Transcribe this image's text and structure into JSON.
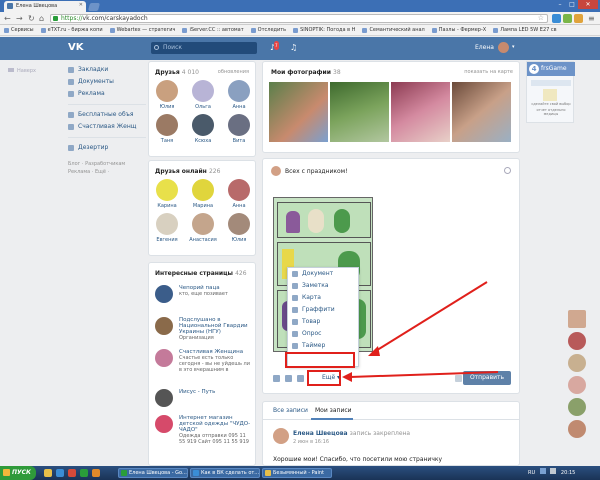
{
  "browser": {
    "tab_title": "Елена Швецова",
    "url_https": "https://",
    "url_rest": "vk.com/carskayadoch",
    "bookmarks": [
      "Сервисы",
      "eTXT.ru - биржа копи",
      "Webartex — стратегич",
      "iServer.CC :: автомат",
      "Отследить",
      "SINOPTIK: Погода в Н",
      "Семантический анал",
      "Пазлы - Фермер-Х",
      "Лампа LED 5W E27 св"
    ]
  },
  "header": {
    "logo": "VK",
    "search_placeholder": "Поиск",
    "notification_count": "7",
    "user_name": "Елена"
  },
  "left_menu": {
    "items": [
      "Закладки",
      "Документы",
      "Реклама"
    ],
    "items2": [
      "Бесплатные объя",
      "Счастливая Женщ"
    ],
    "items3": [
      "Дезертир"
    ],
    "footer1": "Блог · Разработчикам",
    "footer2": "Реклама · Ещё ·"
  },
  "side_far": {
    "label": "Наверх"
  },
  "friends": {
    "title": "Друзья",
    "count": "4 010",
    "link": "обновления",
    "names": [
      "Юлия",
      "Ольга",
      "Анна",
      "Таня",
      "Ксюха",
      "Вита"
    ]
  },
  "friends_online": {
    "title": "Друзья онлайн",
    "count": "226",
    "names": [
      "Карина",
      "Марина",
      "Анна",
      "Евгения",
      "Анастасия",
      "Юлия"
    ]
  },
  "pages": {
    "title": "Интересные страницы",
    "count": "426",
    "items": [
      {
        "name": "Чепорий паца",
        "desc": "кто, еще позивает"
      },
      {
        "name": "Подслушано в Национальной Гвардии Украины (НГУ)",
        "desc": "Организация"
      },
      {
        "name": "Счастливая Женщина",
        "desc": "Счастье есть только сегодня - вы не уйдешь ли в это вчерашним в"
      },
      {
        "name": "Иисус - Путь",
        "desc": ""
      },
      {
        "name": "Интернет магазин детской одежды \"ЧУДО-ЧАДО\"",
        "desc": "Одежда отправки 095 11 55 919 Сайт 095 11 55 919"
      }
    ]
  },
  "photos": {
    "title": "Мои фотографии",
    "count": "38",
    "link": "показать на карте"
  },
  "post": {
    "text": "Всех с праздником!",
    "menu": [
      "Документ",
      "Заметка",
      "Карта",
      "Граффити",
      "Товар",
      "Опрос",
      "Таймер"
    ],
    "more_label": "Ещё",
    "send_label": "Отправить"
  },
  "wall": {
    "tab_all": "Все записи",
    "tab_mine": "Мои записи",
    "author": "Елена Швецова",
    "action": "запись закреплена",
    "time": "2 июн в 16:16",
    "text": "Хорошие мои! Спасибо, что посетили мою страничку"
  },
  "widget": {
    "label": "frsGame",
    "line1": "сделайте свой выбор",
    "line2": "отчет отдельно медицы"
  },
  "taskbar": {
    "start": "ПУСК",
    "tasks": [
      "Елена Швецова - Go...",
      "Как в ВК сделать от...",
      "Безымянный - Paint"
    ],
    "lang": "RU",
    "clock": "20:15"
  }
}
